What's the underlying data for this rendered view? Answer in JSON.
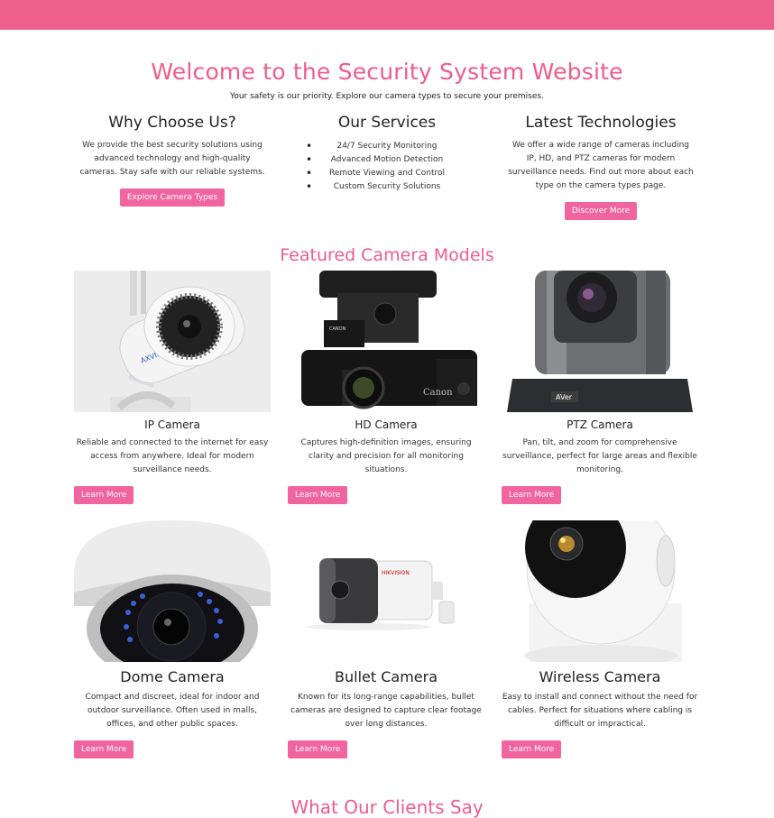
{
  "hero": {
    "title": "Welcome to the Security System Website",
    "subtitle": "Your safety is our priority. Explore our camera types to secure your premises."
  },
  "features": {
    "why": {
      "title": "Why Choose Us?",
      "text": "We provide the best security solutions using advanced technology and high-quality cameras. Stay safe with our reliable systems.",
      "button": "Explore Camera Types"
    },
    "services": {
      "title": "Our Services",
      "items": [
        "24/7 Security Monitoring",
        "Advanced Motion Detection",
        "Remote Viewing and Control",
        "Custom Security Solutions"
      ]
    },
    "tech": {
      "title": "Latest Technologies",
      "text": "We offer a wide range of cameras including IP, HD, and PTZ cameras for modern surveillance needs. Find out more about each type on the camera types page.",
      "button": "Discover More"
    }
  },
  "featured": {
    "title": "Featured Camera Models",
    "cards": [
      {
        "name": "IP Camera",
        "text": "Reliable and connected to the internet for easy access from anywhere. Ideal for modern surveillance needs.",
        "button": "Learn More",
        "brand": "AXVISION"
      },
      {
        "name": "HD Camera",
        "text": "Captures high-definition images, ensuring clarity and precision for all monitoring situations.",
        "button": "Learn More",
        "brand": "Canon"
      },
      {
        "name": "PTZ Camera",
        "text": "Pan, tilt, and zoom for comprehensive surveillance, perfect for large areas and flexible monitoring.",
        "button": "Learn More",
        "brand": "AVer"
      },
      {
        "name": "Dome Camera",
        "text": "Compact and discreet, ideal for indoor and outdoor surveillance. Often used in malls, offices, and other public spaces.",
        "button": "Learn More",
        "brand": ""
      },
      {
        "name": "Bullet Camera",
        "text": "Known for its long-range capabilities, bullet cameras are designed to capture clear footage over long distances.",
        "button": "Learn More",
        "brand": "HIKVISION"
      },
      {
        "name": "Wireless Camera",
        "text": "Easy to install and connect without the need for cables. Perfect for situations where cabling is difficult or impractical.",
        "button": "Learn More",
        "brand": ""
      }
    ]
  },
  "testimonials": {
    "title": "What Our Clients Say"
  },
  "colors": {
    "accent": "#f0608e",
    "button": "#f064a0"
  }
}
